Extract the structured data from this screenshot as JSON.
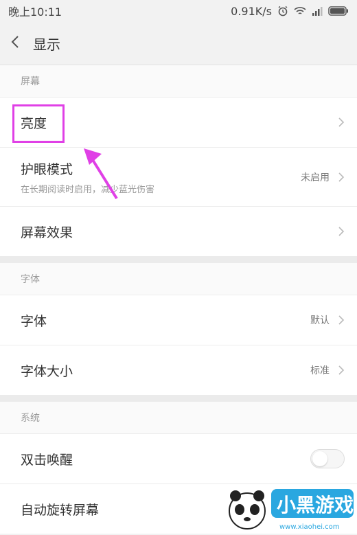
{
  "status": {
    "time": "晚上10:11",
    "speed": "0.91K/s",
    "icons": [
      "alarm-icon",
      "wifi-icon",
      "signal-icon",
      "battery-icon"
    ]
  },
  "header": {
    "title": "显示",
    "back_icon": "chevron-left-icon"
  },
  "sections": {
    "screen": {
      "label": "屏幕",
      "items": [
        {
          "label": "亮度"
        },
        {
          "label": "护眼模式",
          "subtitle": "在长期阅读时启用，减少蓝光伤害",
          "value": "未启用"
        },
        {
          "label": "屏幕效果"
        }
      ]
    },
    "font": {
      "label": "字体",
      "items": [
        {
          "label": "字体",
          "value": "默认"
        },
        {
          "label": "字体大小",
          "value": "标准"
        }
      ]
    },
    "system": {
      "label": "系统",
      "items": [
        {
          "label": "双击唤醒",
          "toggle_on": false
        },
        {
          "label": "自动旋转屏幕"
        }
      ]
    }
  },
  "annotation": {
    "highlight_color": "#e040e6"
  },
  "watermark": {
    "brand": "小黑游戏",
    "url": "www.xiaohei.com"
  }
}
